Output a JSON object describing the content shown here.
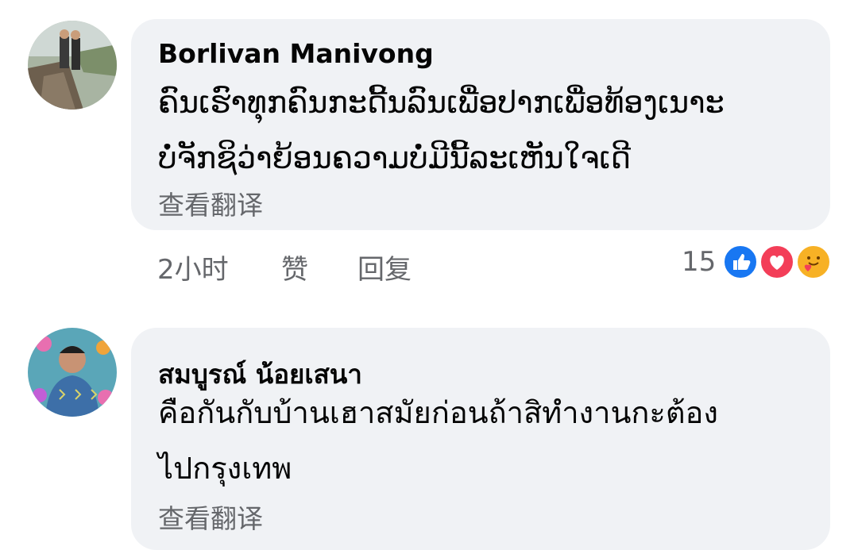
{
  "comments": [
    {
      "author": "Borlivan Manivong",
      "lines": [
        "ຄົນເຮົາທຸກຄົນກະດີ້ນລົນເພື່ອປາກເພື່ອທ້ອງເນາະ",
        "ບໍ່ຈັກຊິວ່າຍ້ອນຄວາມບໍ່ມີນີ້ລະເຫັນໃຈເດີ"
      ],
      "translate": "查看翻译",
      "time": "2小时",
      "like": "赞",
      "reply": "回复",
      "reaction_count": "15",
      "reactions": [
        "like-icon",
        "love-icon",
        "care-icon"
      ]
    },
    {
      "author": "สมบูรณ์ น้อยเสนา",
      "lines": [
        "คือกันกับบ้านเฮาสมัยก่อนถ้าสิทำงานกะต้อง",
        "ไปกรุงเทพ"
      ],
      "translate": "查看翻译"
    }
  ],
  "colors": {
    "bubble": "#f0f2f5",
    "secondary_text": "#65676b",
    "like_blue": "#1877f2",
    "love_red": "#f33e58",
    "care_yellow": "#f7b125"
  }
}
